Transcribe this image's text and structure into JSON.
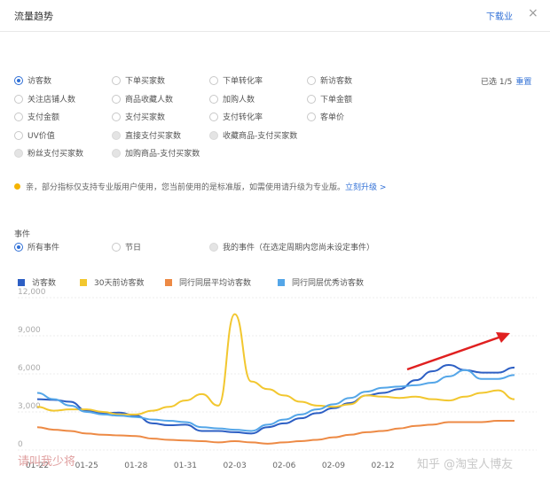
{
  "header": {
    "title": "流量趋势",
    "download": "下载",
    "download_suffix": "业",
    "close": "×"
  },
  "metrics": {
    "selected_label": "已选 1/5",
    "reset_label": "重置",
    "items": [
      {
        "label": "访客数",
        "state": "selected"
      },
      {
        "label": "下单买家数",
        "state": "normal"
      },
      {
        "label": "下单转化率",
        "state": "normal"
      },
      {
        "label": "新访客数",
        "state": "normal"
      },
      {
        "label": "关注店铺人数",
        "state": "normal"
      },
      {
        "label": "商品收藏人数",
        "state": "normal"
      },
      {
        "label": "加购人数",
        "state": "normal"
      },
      {
        "label": "下单金额",
        "state": "normal"
      },
      {
        "label": "支付金额",
        "state": "normal"
      },
      {
        "label": "支付买家数",
        "state": "normal"
      },
      {
        "label": "支付转化率",
        "state": "normal"
      },
      {
        "label": "客单价",
        "state": "normal"
      },
      {
        "label": "UV价值",
        "state": "normal"
      },
      {
        "label": "直接支付买家数",
        "state": "disabled"
      },
      {
        "label": "收藏商品-支付买家数",
        "state": "disabled"
      },
      {
        "label": "",
        "state": "hidden"
      },
      {
        "label": "粉丝支付买家数",
        "state": "disabled"
      },
      {
        "label": "加购商品-支付买家数",
        "state": "disabled"
      }
    ]
  },
  "notice": {
    "text": "亲，部分指标仅支持专业版用户使用，您当前使用的是标准版，如需使用请升级为专业版。",
    "link": "立刻升级 >",
    "dot_color": "#f5b400"
  },
  "events": {
    "label": "事件",
    "items": [
      {
        "label": "所有事件",
        "state": "selected"
      },
      {
        "label": "节日",
        "state": "normal"
      },
      {
        "label": "我的事件（在选定周期内您尚未设定事件）",
        "state": "disabled"
      }
    ]
  },
  "watermarks": {
    "left": "请叫我少将",
    "right": "知乎 @淘宝人博友"
  },
  "chart_data": {
    "type": "line",
    "yticks": [
      "12,000",
      "9,000",
      "6,000",
      "3,000",
      "0"
    ],
    "ylim": [
      0,
      12000
    ],
    "xticks": [
      "01-22",
      "01-25",
      "01-28",
      "01-31",
      "02-03",
      "02-06",
      "02-09",
      "02-12"
    ],
    "x": [
      "01-22",
      "01-23",
      "01-24",
      "01-25",
      "01-26",
      "01-27",
      "01-28",
      "01-29",
      "01-30",
      "01-31",
      "02-01",
      "02-02",
      "02-03",
      "02-04",
      "02-05",
      "02-06",
      "02-07",
      "02-08",
      "02-09",
      "02-10",
      "02-11",
      "02-12",
      "02-13",
      "02-14",
      "02-15",
      "02-16",
      "02-17",
      "02-18",
      "02-19",
      "02-20"
    ],
    "series": [
      {
        "name": "访客数",
        "color": "#2d5fc4",
        "values": [
          4000,
          3950,
          3800,
          3100,
          2900,
          2950,
          2700,
          2100,
          1950,
          2000,
          1500,
          1500,
          1400,
          1300,
          1800,
          2100,
          2500,
          2900,
          3300,
          3700,
          4300,
          4500,
          4800,
          5500,
          6200,
          6700,
          6300,
          6100,
          6100,
          6500
        ]
      },
      {
        "name": "30天前访客数",
        "color": "#f2c72f",
        "values": [
          3400,
          3100,
          3200,
          3200,
          3000,
          2800,
          2800,
          3100,
          3400,
          3900,
          4400,
          3500,
          10700,
          5400,
          4800,
          4300,
          3800,
          3500,
          3400,
          3600,
          4300,
          4200,
          4100,
          4200,
          4000,
          3900,
          4200,
          4500,
          4700,
          4000
        ]
      },
      {
        "name": "同行同层平均访客数",
        "color": "#ed8a45",
        "values": [
          1800,
          1600,
          1500,
          1300,
          1200,
          1150,
          1100,
          900,
          800,
          750,
          700,
          600,
          700,
          600,
          500,
          600,
          700,
          800,
          1000,
          1200,
          1400,
          1500,
          1700,
          1900,
          2000,
          2200,
          2200,
          2200,
          2300,
          2300
        ]
      },
      {
        "name": "同行同层优秀访客数",
        "color": "#54a6e8",
        "values": [
          4500,
          4000,
          3500,
          3000,
          2800,
          2700,
          2600,
          2400,
          2300,
          2200,
          1800,
          1700,
          1600,
          1500,
          2000,
          2400,
          2800,
          3200,
          3600,
          4100,
          4600,
          4900,
          5000,
          5100,
          5300,
          5800,
          6300,
          5600,
          5600,
          5900
        ]
      }
    ]
  }
}
